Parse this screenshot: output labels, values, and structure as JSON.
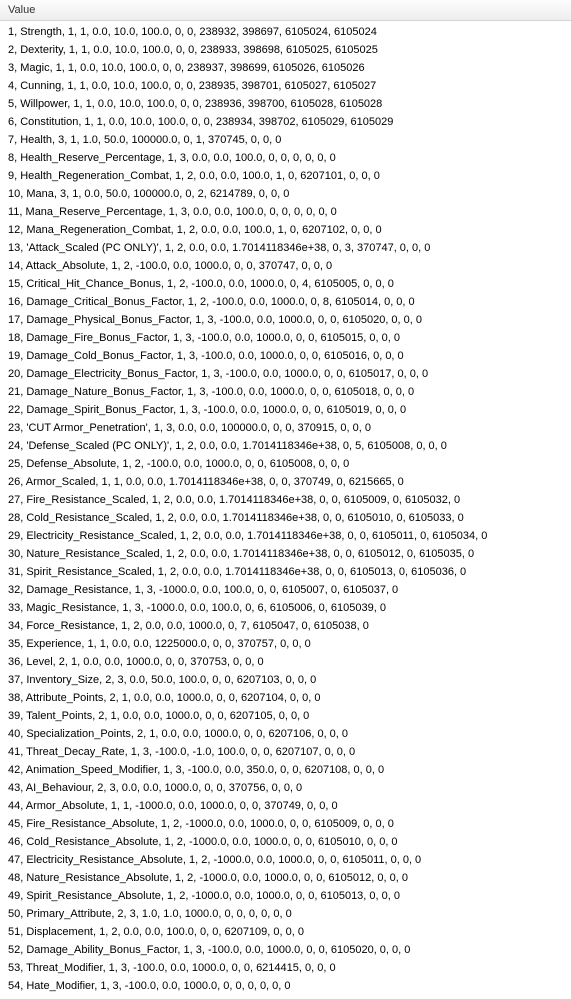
{
  "header": {
    "label": "Value"
  },
  "rows": [
    "1, Strength, 1, 1, 0.0, 10.0, 100.0, 0, 0, 238932, 398697, 6105024, 6105024",
    "2, Dexterity, 1, 1, 0.0, 10.0, 100.0, 0, 0, 238933, 398698, 6105025, 6105025",
    "3, Magic, 1, 1, 0.0, 10.0, 100.0, 0, 0, 238937, 398699, 6105026, 6105026",
    "4, Cunning, 1, 1, 0.0, 10.0, 100.0, 0, 0, 238935, 398701, 6105027, 6105027",
    "5, Willpower, 1, 1, 0.0, 10.0, 100.0, 0, 0, 238936, 398700, 6105028, 6105028",
    "6, Constitution, 1, 1, 0.0, 10.0, 100.0, 0, 0, 238934, 398702, 6105029, 6105029",
    "7, Health, 3, 1, 1.0, 50.0, 100000.0, 0, 1, 370745, 0, 0, 0",
    "8, Health_Reserve_Percentage, 1, 3, 0.0, 0.0, 100.0, 0, 0, 0, 0, 0, 0",
    "9, Health_Regeneration_Combat, 1, 2, 0.0, 0.0, 100.0, 1, 0, 6207101, 0, 0, 0",
    "10, Mana, 3, 1, 0.0, 50.0, 100000.0, 0, 2, 6214789, 0, 0, 0",
    "11, Mana_Reserve_Percentage, 1, 3, 0.0, 0.0, 100.0, 0, 0, 0, 0, 0, 0",
    "12, Mana_Regeneration_Combat, 1, 2, 0.0, 0.0, 100.0, 1, 0, 6207102, 0, 0, 0",
    "13, 'Attack_Scaled (PC ONLY)', 1, 2, 0.0, 0.0, 1.7014118346e+38, 0, 3, 370747, 0, 0, 0",
    "14, Attack_Absolute, 1, 2, -100.0, 0.0, 1000.0, 0, 0, 370747, 0, 0, 0",
    "15, Critical_Hit_Chance_Bonus, 1, 2, -100.0, 0.0, 1000.0, 0, 4, 6105005, 0, 0, 0",
    "16, Damage_Critical_Bonus_Factor, 1, 2, -100.0, 0.0, 1000.0, 0, 8, 6105014, 0, 0, 0",
    "17, Damage_Physical_Bonus_Factor, 1, 3, -100.0, 0.0, 1000.0, 0, 0, 6105020, 0, 0, 0",
    "18, Damage_Fire_Bonus_Factor, 1, 3, -100.0, 0.0, 1000.0, 0, 0, 6105015, 0, 0, 0",
    "19, Damage_Cold_Bonus_Factor, 1, 3, -100.0, 0.0, 1000.0, 0, 0, 6105016, 0, 0, 0",
    "20, Damage_Electricity_Bonus_Factor, 1, 3, -100.0, 0.0, 1000.0, 0, 0, 6105017, 0, 0, 0",
    "21, Damage_Nature_Bonus_Factor, 1, 3, -100.0, 0.0, 1000.0, 0, 0, 6105018, 0, 0, 0",
    "22, Damage_Spirit_Bonus_Factor, 1, 3, -100.0, 0.0, 1000.0, 0, 0, 6105019, 0, 0, 0",
    "23, 'CUT Armor_Penetration', 1, 3, 0.0, 0.0, 100000.0, 0, 0, 370915, 0, 0, 0",
    "24, 'Defense_Scaled (PC ONLY)', 1, 2, 0.0, 0.0, 1.7014118346e+38, 0, 5, 6105008, 0, 0, 0",
    "25, Defense_Absolute, 1, 2, -100.0, 0.0, 1000.0, 0, 0, 6105008, 0, 0, 0",
    "26, Armor_Scaled, 1, 1, 0.0, 0.0, 1.7014118346e+38, 0, 0, 370749, 0, 6215665, 0",
    "27, Fire_Resistance_Scaled, 1, 2, 0.0, 0.0, 1.7014118346e+38, 0, 0, 6105009, 0, 6105032, 0",
    "28, Cold_Resistance_Scaled, 1, 2, 0.0, 0.0, 1.7014118346e+38, 0, 0, 6105010, 0, 6105033, 0",
    "29, Electricity_Resistance_Scaled, 1, 2, 0.0, 0.0, 1.7014118346e+38, 0, 0, 6105011, 0, 6105034, 0",
    "30, Nature_Resistance_Scaled, 1, 2, 0.0, 0.0, 1.7014118346e+38, 0, 0, 6105012, 0, 6105035, 0",
    "31, Spirit_Resistance_Scaled, 1, 2, 0.0, 0.0, 1.7014118346e+38, 0, 0, 6105013, 0, 6105036, 0",
    "32, Damage_Resistance, 1, 3, -1000.0, 0.0, 100.0, 0, 0, 6105007, 0, 6105037, 0",
    "33, Magic_Resistance, 1, 3, -1000.0, 0.0, 100.0, 0, 6, 6105006, 0, 6105039, 0",
    "34, Force_Resistance, 1, 2, 0.0, 0.0, 1000.0, 0, 7, 6105047, 0, 6105038, 0",
    "35, Experience, 1, 1, 0.0, 0.0, 1225000.0, 0, 0, 370757, 0, 0, 0",
    "36, Level, 2, 1, 0.0, 0.0, 1000.0, 0, 0, 370753, 0, 0, 0",
    "37, Inventory_Size, 2, 3, 0.0, 50.0, 100.0, 0, 0, 6207103, 0, 0, 0",
    "38, Attribute_Points, 2, 1, 0.0, 0.0, 1000.0, 0, 0, 6207104, 0, 0, 0",
    "39, Talent_Points, 2, 1, 0.0, 0.0, 1000.0, 0, 0, 6207105, 0, 0, 0",
    "40, Specialization_Points, 2, 1, 0.0, 0.0, 1000.0, 0, 0, 6207106, 0, 0, 0",
    "41, Threat_Decay_Rate, 1, 3, -100.0, -1.0, 100.0, 0, 0, 6207107, 0, 0, 0",
    "42, Animation_Speed_Modifier, 1, 3, -100.0, 0.0, 350.0, 0, 0, 6207108, 0, 0, 0",
    "43, AI_Behaviour, 2, 3, 0.0, 0.0, 1000.0, 0, 0, 370756, 0, 0, 0",
    "44, Armor_Absolute, 1, 1, -1000.0, 0.0, 1000.0, 0, 0, 370749, 0, 0, 0",
    "45, Fire_Resistance_Absolute, 1, 2, -1000.0, 0.0, 1000.0, 0, 0, 6105009, 0, 0, 0",
    "46, Cold_Resistance_Absolute, 1, 2, -1000.0, 0.0, 1000.0, 0, 0, 6105010, 0, 0, 0",
    "47, Electricity_Resistance_Absolute, 1, 2, -1000.0, 0.0, 1000.0, 0, 0, 6105011, 0, 0, 0",
    "48, Nature_Resistance_Absolute, 1, 2, -1000.0, 0.0, 1000.0, 0, 0, 6105012, 0, 0, 0",
    "49, Spirit_Resistance_Absolute, 1, 2, -1000.0, 0.0, 1000.0, 0, 0, 6105013, 0, 0, 0",
    "50, Primary_Attribute, 2, 3, 1.0, 1.0, 1000.0, 0, 0, 0, 0, 0, 0",
    "51, Displacement, 1, 2, 0.0, 0.0, 100.0, 0, 0, 6207109, 0, 0, 0",
    "52, Damage_Ability_Bonus_Factor, 1, 3, -100.0, 0.0, 1000.0, 0, 0, 6105020, 0, 0, 0",
    "53, Threat_Modifier, 1, 3, -100.0, 0.0, 1000.0, 0, 0, 6214415, 0, 0, 0",
    "54, Hate_Modifier, 1, 3, -100.0, 0.0, 1000.0, 0, 0, 0, 0, 0, 0"
  ]
}
